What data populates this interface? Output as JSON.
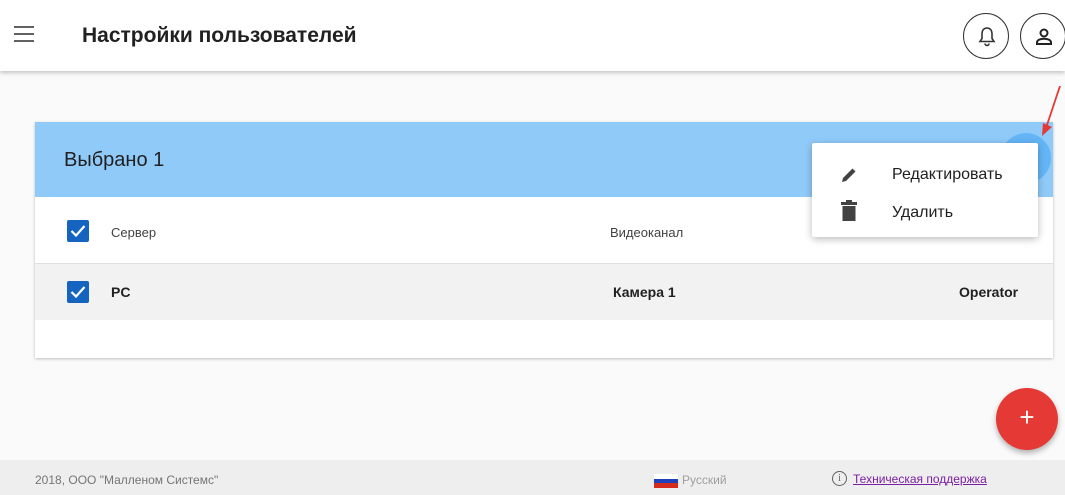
{
  "header": {
    "title": "Настройки пользователей",
    "menu_icon": "hamburger-icon",
    "notification_icon": "bell-icon",
    "account_icon": "user-icon"
  },
  "selection": {
    "title": "Выбрано 1"
  },
  "table": {
    "columns": [
      "Сервер",
      "Видеоканал"
    ],
    "rows": [
      {
        "server": "PC",
        "channel": "Камера 1",
        "role": "Operator",
        "checked": true
      }
    ],
    "select_all_checked": true
  },
  "context_menu": {
    "items": [
      {
        "label": "Редактировать",
        "icon": "pencil-icon"
      },
      {
        "label": "Удалить",
        "icon": "trash-icon"
      }
    ]
  },
  "add_button": {
    "label": "+",
    "color": "#e53935"
  },
  "footer": {
    "copyright": "2018, ООО \"Малленом Системс\"",
    "language": "Русский",
    "support_link": "Техническая поддержка",
    "info_glyph": "i"
  },
  "colors": {
    "header_bg": "#90caf9",
    "checkbox": "#1565c0",
    "annotation_arrow": "#e53935"
  }
}
